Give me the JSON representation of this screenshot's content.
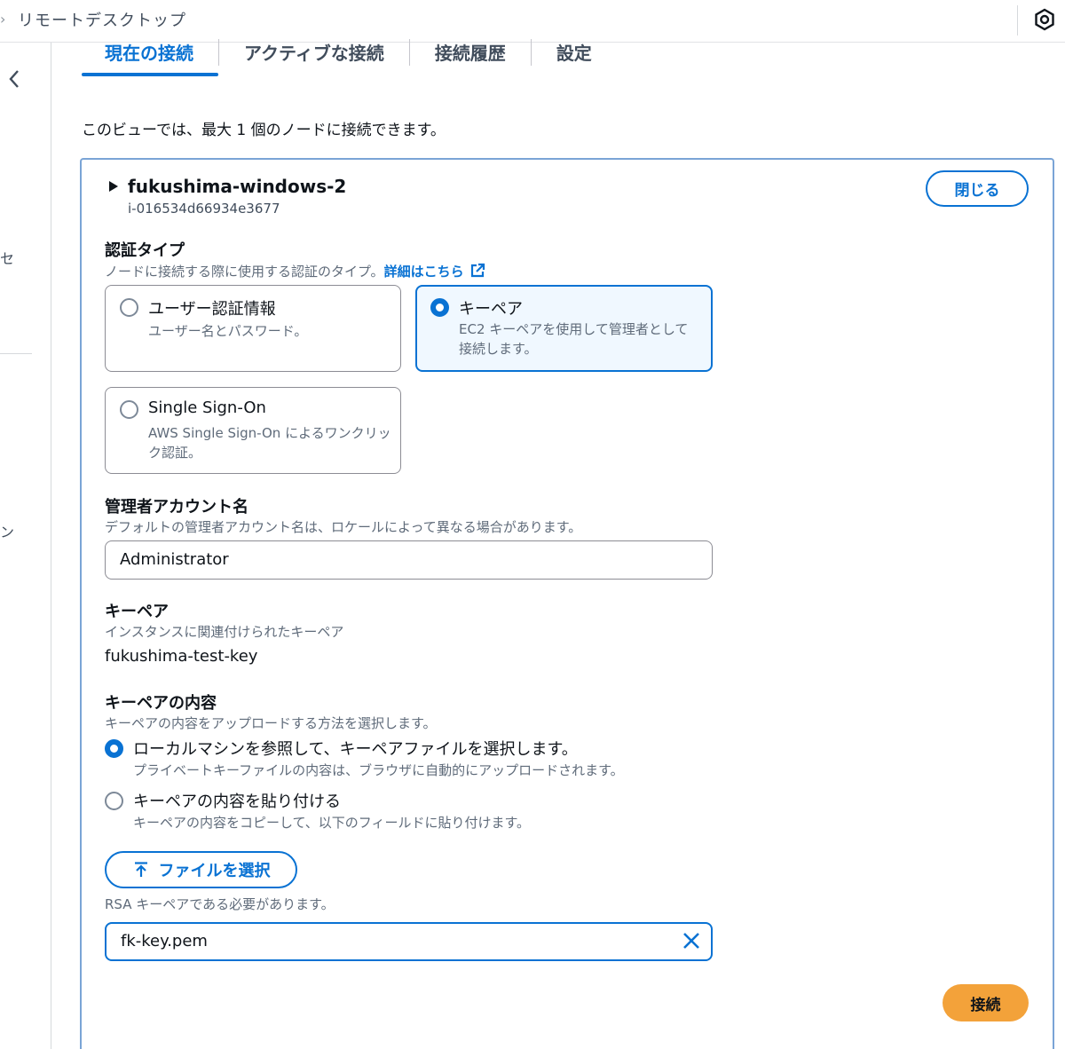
{
  "header": {
    "breadcrumb_separator": "›",
    "breadcrumb": "リモートデスクトップ",
    "icon": "hexagon-settings-icon"
  },
  "leftnav": {
    "back_icon": "chevron-left-icon",
    "fragments": [
      "セ",
      "ン"
    ]
  },
  "tabs": [
    {
      "label": "現在の接続",
      "active": true
    },
    {
      "label": "アクティブな接続",
      "active": false
    },
    {
      "label": "接続履歴",
      "active": false
    },
    {
      "label": "設定",
      "active": false
    }
  ],
  "intro": "このビューでは、最大 1 個のノードに接続できます。",
  "node": {
    "name": "fukushima-windows-2",
    "id": "i-016534d66934e3677",
    "close_label": "閉じる"
  },
  "auth": {
    "label": "認証タイプ",
    "description": "ノードに接続する際に使用する認証のタイプ。",
    "learn_more": "詳細はこちら",
    "options": [
      {
        "title": "ユーザー認証情報",
        "description": "ユーザー名とパスワード。",
        "selected": false
      },
      {
        "title": "キーペア",
        "description": "EC2 キーペアを使用して管理者として接続します。",
        "selected": true
      },
      {
        "title": "Single Sign-On",
        "description": "AWS Single Sign-On によるワンクリック認証。",
        "selected": false
      }
    ]
  },
  "admin": {
    "label": "管理者アカウント名",
    "description": "デフォルトの管理者アカウント名は、ロケールによって異なる場合があります。",
    "value": "Administrator"
  },
  "keypair": {
    "label": "キーペア",
    "description": "インスタンスに関連付けられたキーペア",
    "value": "fukushima-test-key"
  },
  "keycontent": {
    "label": "キーペアの内容",
    "description": "キーペアの内容をアップロードする方法を選択します。",
    "options": [
      {
        "title": "ローカルマシンを参照して、キーペアファイルを選択します。",
        "description": "プライベートキーファイルの内容は、ブラウザに自動的にアップロードされます。",
        "selected": true
      },
      {
        "title": "キーペアの内容を貼り付ける",
        "description": "キーペアの内容をコピーして、以下のフィールドに貼り付けます。",
        "selected": false
      }
    ],
    "file_button": "ファイルを選択",
    "hint": "RSA キーペアである必要があります。",
    "file_value": "fk-key.pem"
  },
  "connect_label": "接続",
  "colors": {
    "accent": "#0972d3",
    "connect": "#f3a23a",
    "panel_border": "#7aa4d6"
  }
}
